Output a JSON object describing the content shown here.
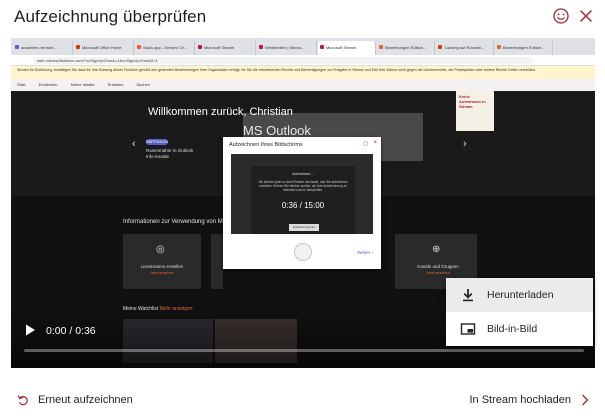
{
  "dialog": {
    "title": "Aufzeichnung überprüfen",
    "icons": {
      "smile": "smile-icon",
      "close": "close-icon"
    }
  },
  "recording": {
    "browser": {
      "tabs": [
        "aussehen.net wird...",
        "Microsoft Office Home",
        "Stack.app - Denken Ch...",
        "Microsoft Stream",
        "Weiterleiten | Micros...",
        "Microsoft Stream",
        "Bewerbungen Edition...",
        "Caching auf Rosnerli...",
        "Bewerbungen Edition..."
      ],
      "address": "web.microsoftstream.com/?noSignUpCheck=1&noSignUpCheck2=1",
      "notice": "Stream für Einführung, bestätigen Sie dass Ihr Ihre Nutzung dieser Funktion gemäß den geltenden Bestimmungen Ihrer Organisation erfolgt. Ihr Sie die erforderlichen Rechte und Berechtigungen zur Freigabe in Stream und Edit Ihre Videos nicht gegen die Urheberrechte, die Privatsphäre oder andere Rechte Dritter verstoßen.",
      "ms_bar": [
        "Start",
        "Entdecken",
        "Meine Inhalte",
        "Erstellen",
        "Suchen"
      ]
    },
    "hero": {
      "welcome": "Willkommen zurück, Christian",
      "subtitle": "MS Outlook",
      "pill": "EMPFOHLEN",
      "card_line1": "Rasenmäher in Outlook",
      "card_line2": "Info-Kanäle"
    },
    "stop_card": "Keine Aufnahmen in Stream",
    "info_heading": "Informationen zur Verwendung von M",
    "tiles": [
      {
        "label": "Livestreams erstellen",
        "link": "Jetzt ansehen"
      },
      {
        "label": "Kanäle und Gruppen",
        "link": "Jetzt ansehen"
      }
    ],
    "watchlist": {
      "heading": "Meine Watchlist",
      "link": "Mehr anzeigen"
    },
    "record_dialog": {
      "title": "Aufzeichnen Ihres Bildschirms",
      "status": "Aufnahme...",
      "message": "Sie können jetzt zu dem Fenster wechseln, das Sie aufnehmen möchten. Kehren Sie hierher zurück, um Ihre Aufzeichnung zu beenden und zu überprüfen.",
      "timer": "0:36 / 15:00",
      "mini_label": "Aufnahme beenden",
      "next": "Weiter"
    }
  },
  "player": {
    "time": "0:00 / 0:36",
    "progress": 0.0
  },
  "menu": {
    "items": [
      {
        "label": "Herunterladen",
        "icon": "download-icon",
        "highlighted": true
      },
      {
        "label": "Bild-in-Bild",
        "icon": "picture-in-picture-icon",
        "highlighted": false
      }
    ]
  },
  "footer": {
    "retake_label": "Erneut aufzeichnen",
    "upload_label": "In Stream hochladen"
  },
  "colors": {
    "accent": "#a4262c",
    "link": "#5b5fc7"
  }
}
